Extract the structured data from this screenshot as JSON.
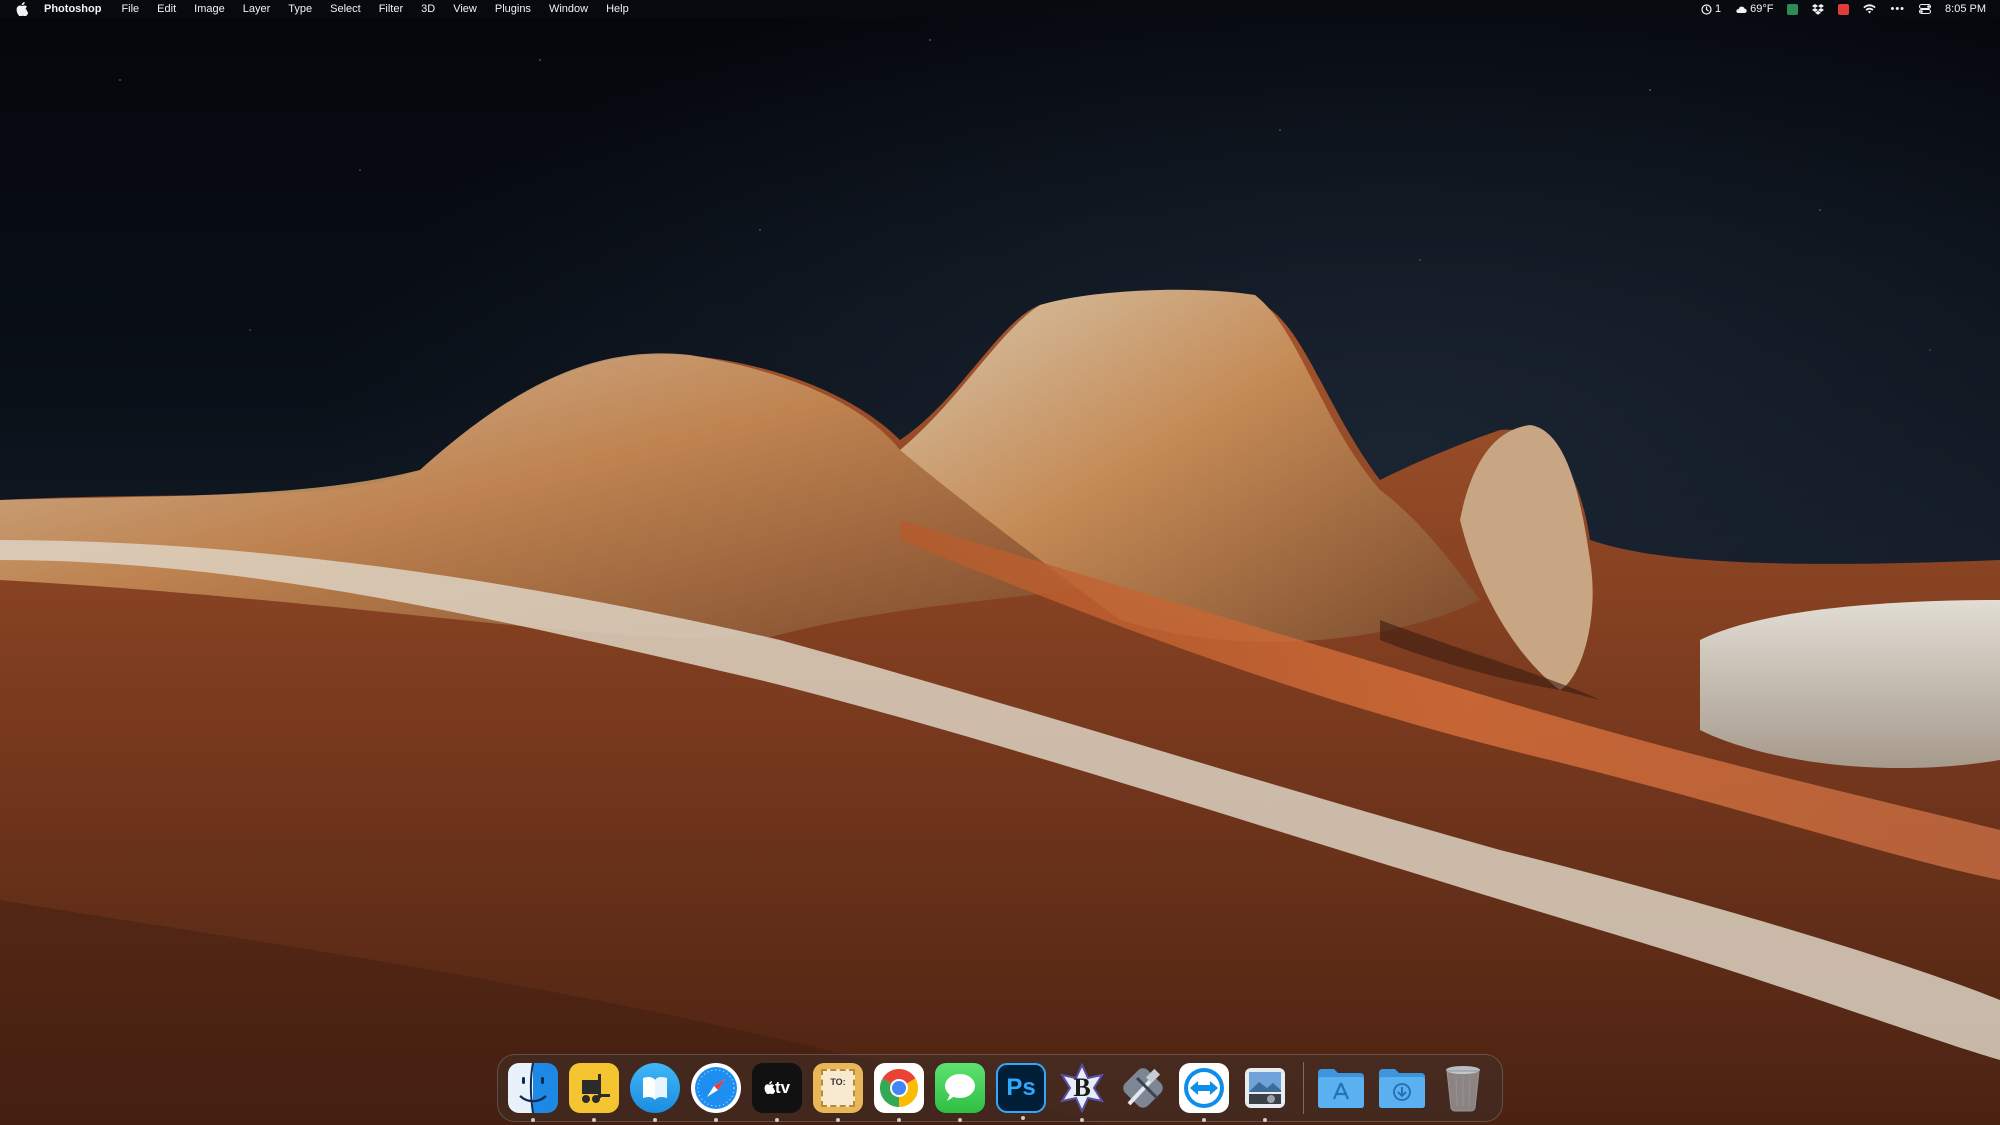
{
  "menubar": {
    "app_name": "Photoshop",
    "menus": [
      "File",
      "Edit",
      "Image",
      "Layer",
      "Type",
      "Select",
      "Filter",
      "3D",
      "View",
      "Plugins",
      "Window",
      "Help"
    ],
    "status": {
      "screen_time_count": "1",
      "weather": "69°F",
      "clock": "8:05 PM"
    }
  },
  "dock": {
    "apps": [
      {
        "name": "Finder",
        "icon": "finder-icon",
        "running": true
      },
      {
        "name": "Transmit",
        "icon": "forklift-icon",
        "running": true
      },
      {
        "name": "Books",
        "icon": "books-icon",
        "running": true
      },
      {
        "name": "Safari",
        "icon": "safari-compass-icon",
        "running": true
      },
      {
        "name": "TV",
        "icon": "apple-tv-icon",
        "label": "tv",
        "running": true
      },
      {
        "name": "Stamps",
        "icon": "stamps-icon",
        "label": "TO:",
        "running": true
      },
      {
        "name": "Google Chrome",
        "icon": "chrome-icon",
        "running": true
      },
      {
        "name": "Messages",
        "icon": "messages-icon",
        "running": true
      },
      {
        "name": "Photoshop",
        "icon": "photoshop-icon",
        "label": "Ps",
        "running": true
      },
      {
        "name": "BBEdit",
        "icon": "bbedit-icon",
        "label": "B",
        "running": true
      },
      {
        "name": "Xcode",
        "icon": "xcode-icon",
        "running": false
      },
      {
        "name": "TeamViewer",
        "icon": "teamviewer-icon",
        "running": true
      },
      {
        "name": "Preview",
        "icon": "preview-icon",
        "running": true
      }
    ],
    "stacks": [
      {
        "name": "Applications",
        "icon": "applications-folder-icon"
      },
      {
        "name": "Downloads",
        "icon": "downloads-folder-icon"
      },
      {
        "name": "Trash",
        "icon": "trash-icon"
      }
    ]
  },
  "colors": {
    "photoshop_blue": "#31a8ff",
    "photoshop_bg": "#001e36",
    "messages_green": "#34c759",
    "folder_blue": "#4aa3e8",
    "finder_blue": "#1e88e5",
    "dock_bg": "rgba(60,48,44,0.45)"
  }
}
